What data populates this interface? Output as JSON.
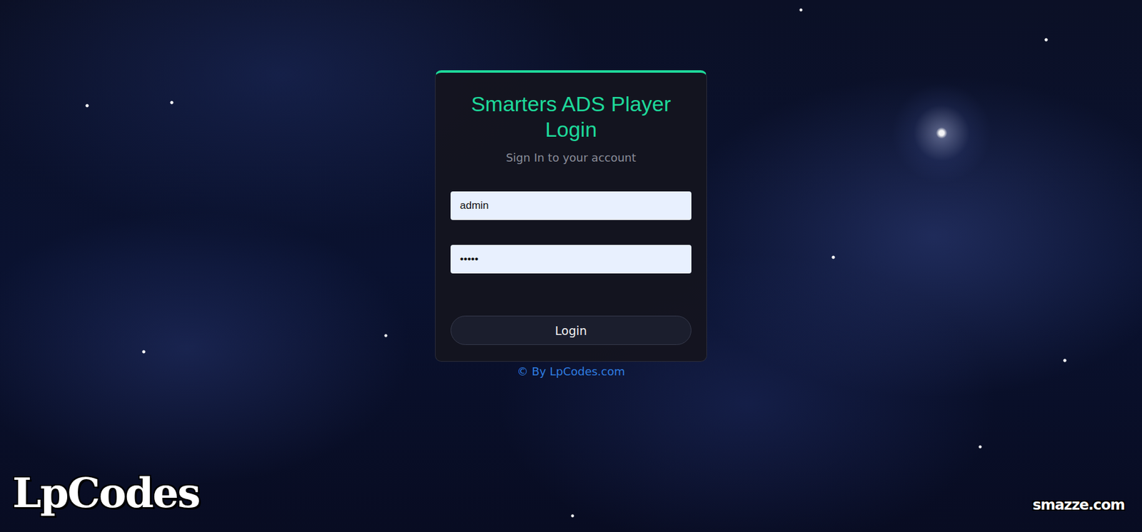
{
  "login": {
    "title": "Smarters ADS Player Login",
    "subtitle": "Sign In to your account",
    "fields": [
      {
        "name": "username",
        "type": "text",
        "value": "admin"
      },
      {
        "name": "password",
        "type": "password",
        "value": "•••••"
      }
    ],
    "button": "Login"
  },
  "footer": "© By LpCodes.com",
  "watermarks": {
    "left": "LpCodes",
    "right": "smazze.com"
  }
}
